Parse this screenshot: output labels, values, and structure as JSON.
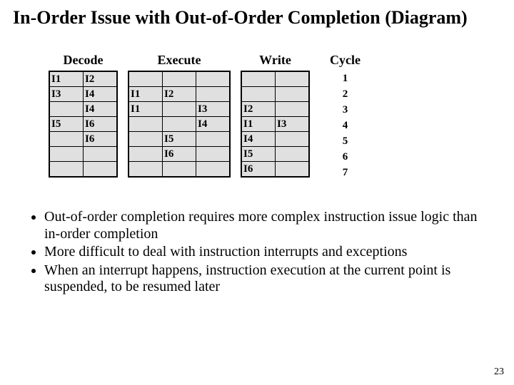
{
  "title": "In-Order Issue with Out-of-Order Completion (Diagram)",
  "stages": {
    "decode": {
      "header": "Decode",
      "cells": [
        [
          "I1",
          "I2"
        ],
        [
          "I3",
          "I4"
        ],
        [
          "",
          "I4"
        ],
        [
          "I5",
          "I6"
        ],
        [
          "",
          "I6"
        ],
        [
          "",
          ""
        ],
        [
          "",
          ""
        ]
      ]
    },
    "execute": {
      "header": "Execute",
      "cells": [
        [
          "",
          "",
          ""
        ],
        [
          "I1",
          "I2",
          ""
        ],
        [
          "I1",
          "",
          "I3"
        ],
        [
          "",
          "",
          "I4"
        ],
        [
          "",
          "I5",
          ""
        ],
        [
          "",
          "I6",
          ""
        ],
        [
          "",
          "",
          ""
        ]
      ]
    },
    "write": {
      "header": "Write",
      "cells": [
        [
          "",
          ""
        ],
        [
          "",
          ""
        ],
        [
          "I2",
          ""
        ],
        [
          "I1",
          "I3"
        ],
        [
          "I4",
          ""
        ],
        [
          "I5",
          ""
        ],
        [
          "I6",
          ""
        ]
      ]
    }
  },
  "cycle": {
    "header": "Cycle",
    "values": [
      "1",
      "2",
      "3",
      "4",
      "5",
      "6",
      "7"
    ]
  },
  "bullets": [
    "Out-of-order completion requires more complex instruction issue logic than in-order completion",
    "More difficult to deal with instruction interrupts and exceptions",
    "When an interrupt happens, instruction execution at the current point is suspended, to be resumed later"
  ],
  "page_number": "23"
}
